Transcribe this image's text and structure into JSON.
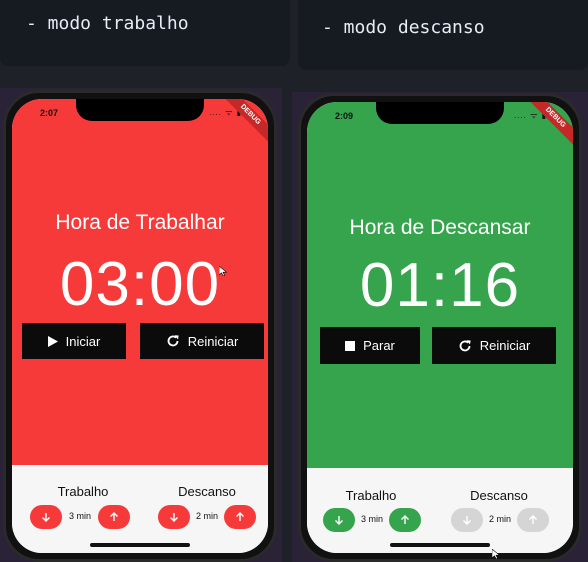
{
  "captions": {
    "left": "- modo trabalho",
    "right": "- modo descanso"
  },
  "colors": {
    "work_bg": "#f63a3a",
    "rest_bg": "#35a44c",
    "button_bg": "#0b0b0b",
    "disabled_round": "#d5d5d5"
  },
  "phones": [
    {
      "status_time": "2:07",
      "status_icons": ".... ᯤ ▮",
      "debug_label": "DEBUG",
      "title": "Hora de Trabalhar",
      "timer": "03:00",
      "primary_button": {
        "label": "Iniciar",
        "icon": "play-icon"
      },
      "secondary_button": {
        "label": "Reiniciar",
        "icon": "refresh-icon"
      },
      "work": {
        "label": "Trabalho",
        "value": "3 min"
      },
      "rest": {
        "label": "Descanso",
        "value": "2 min"
      }
    },
    {
      "status_time": "2:09",
      "status_icons": ".... ᯤ ▮",
      "debug_label": "DEBUG",
      "title": "Hora de Descansar",
      "timer": "01:16",
      "primary_button": {
        "label": "Parar",
        "icon": "stop-icon"
      },
      "secondary_button": {
        "label": "Reiniciar",
        "icon": "refresh-icon"
      },
      "work": {
        "label": "Trabalho",
        "value": "3 min"
      },
      "rest": {
        "label": "Descanso",
        "value": "2 min"
      }
    }
  ]
}
